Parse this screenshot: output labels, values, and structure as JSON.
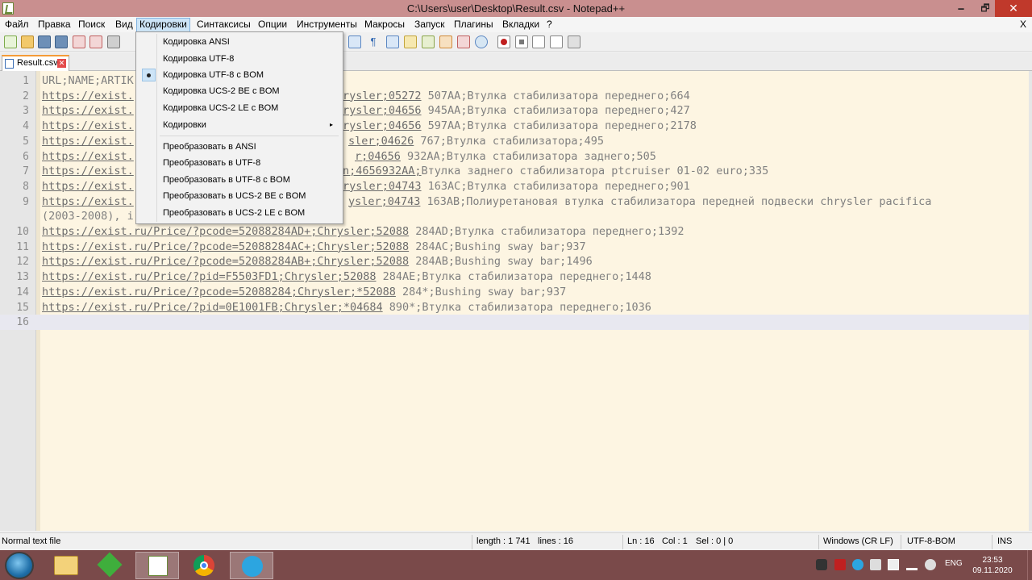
{
  "window": {
    "title": "C:\\Users\\user\\Desktop\\Result.csv - Notepad++",
    "minimize_glyph": "🗕",
    "maximize_glyph": "🗗",
    "close_glyph": "✕"
  },
  "menubar": {
    "items": [
      "Файл",
      "Правка",
      "Поиск",
      "Вид",
      "Кодировки",
      "Синтаксисы",
      "Опции",
      "Инструменты",
      "Макросы",
      "Запуск",
      "Плагины",
      "Вкладки",
      "?"
    ],
    "active": "Кодировки",
    "close_glyph": "X"
  },
  "tab": {
    "label": "Result.csv",
    "close_glyph": "✕"
  },
  "editor": {
    "lines": [
      {
        "n": "1",
        "link": "",
        "text": "URL;NAME;ARTIK"
      },
      {
        "n": "2",
        "link": "https://exist.",
        "text": ""
      },
      {
        "n": "3",
        "link": "https://exist.",
        "text": ""
      },
      {
        "n": "4",
        "link": "https://exist.",
        "text": ""
      },
      {
        "n": "5",
        "link": "https://exist.",
        "text": ""
      },
      {
        "n": "6",
        "link": "https://exist.",
        "text": ""
      },
      {
        "n": "7",
        "link": "https://exist.",
        "text": ""
      },
      {
        "n": "8",
        "link": "https://exist.",
        "text": ""
      },
      {
        "n": "9",
        "link": "https://exist.",
        "text": ""
      },
      {
        "n": "",
        "link": "",
        "text": "(2003-2008), i"
      },
      {
        "n": "10",
        "link": "https://exist.ru/Price/?pcode=52088284AD+;Chrysler;52088",
        "text": " 284AD;Втулка стабилизатора переднего;1392"
      },
      {
        "n": "11",
        "link": "https://exist.ru/Price/?pcode=52088284AC+;Chrysler;52088",
        "text": " 284AC;Bushing sway bar;937"
      },
      {
        "n": "12",
        "link": "https://exist.ru/Price/?pcode=52088284AB+;Chrysler;52088",
        "text": " 284AB;Bushing sway bar;1496"
      },
      {
        "n": "13",
        "link": "https://exist.ru/Price/?pid=F5503FD1;Chrysler;52088",
        "text": " 284AE;Втулка стабилизатора переднего;1448"
      },
      {
        "n": "14",
        "link": "https://exist.ru/Price/?pcode=52088284;Chrysler;*52088",
        "text": " 284*;Bushing sway bar;937"
      },
      {
        "n": "15",
        "link": "https://exist.ru/Price/?pid=0E1001FB;Chrysler;*04684",
        "text": " 890*;Втулка стабилизатора переднего;1036"
      },
      {
        "n": "16",
        "link": "",
        "text": ""
      }
    ],
    "right_fragments": [
      {
        "link": "rysler;05272",
        "text": " 507AA;Втулка стабилизатора переднего;664"
      },
      {
        "link": "rysler;04656",
        "text": " 945AA;Втулка стабилизатора переднего;427"
      },
      {
        "link": "rysler;04656",
        "text": " 597AA;Втулка стабилизатора переднего;2178"
      },
      {
        "link": "sler;04626",
        "text": " 767;Втулка стабилизатора;495"
      },
      {
        "link": "r;04656",
        "text": " 932AA;Втулка стабилизатора заднего;505"
      },
      {
        "link": "n;4656932AA;",
        "text": "Втулка заднего стабилизатора ptcruiser 01-02 euro;335"
      },
      {
        "link": "rysler;04743",
        "text": " 163AC;Втулка стабилизатора переднего;901"
      },
      {
        "link": "ysler;04743",
        "text": " 163AB;Полиуретановая втулка стабилизатора передней подвески chrysler pacifica"
      }
    ]
  },
  "dropdown": {
    "items": [
      {
        "label": "Кодировка ANSI",
        "checked": false
      },
      {
        "label": "Кодировка UTF-8",
        "checked": false
      },
      {
        "label": "Кодировка UTF-8 с BOM",
        "checked": true
      },
      {
        "label": "Кодировка UCS-2 BE с BOM",
        "checked": false
      },
      {
        "label": "Кодировка UCS-2 LE с BOM",
        "checked": false
      },
      {
        "label": "Кодировки",
        "checked": false,
        "submenu": true
      },
      {
        "label": "Преобразовать в ANSI",
        "checked": false
      },
      {
        "label": "Преобразовать в UTF-8",
        "checked": false
      },
      {
        "label": "Преобразовать в UTF-8 с BOM",
        "checked": false
      },
      {
        "label": "Преобразовать в UCS-2 BE с BOM",
        "checked": false
      },
      {
        "label": "Преобразовать в UCS-2 LE с BOM",
        "checked": false
      }
    ],
    "submenu_arrow": "▸"
  },
  "statusbar": {
    "file_type": "Normal text file",
    "length": "length : 1 741",
    "lines": "lines : 16",
    "ln": "Ln : 16",
    "col": "Col : 1",
    "sel": "Sel : 0 | 0",
    "eol": "Windows (CR LF)",
    "encoding": "UTF-8-BOM",
    "mode": "INS"
  },
  "taskbar": {
    "lang": "ENG",
    "time": "23:53",
    "date": "09.11.2020"
  },
  "colors": {
    "titlebar": "#c98f8f",
    "editor_bg": "#fdf5e2",
    "taskbar": "#7a4a4a",
    "menu_highlight": "#cce4f7"
  }
}
